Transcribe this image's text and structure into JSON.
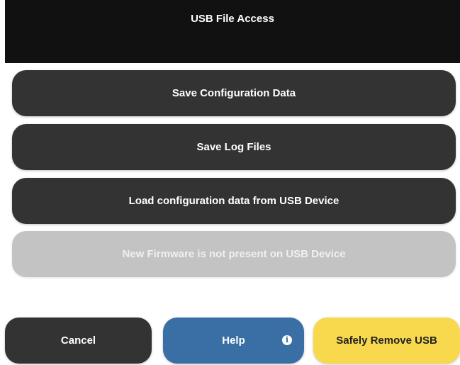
{
  "header": {
    "title": "USB File Access"
  },
  "actions": [
    {
      "label": "Save Configuration Data",
      "enabled": true
    },
    {
      "label": "Save Log Files",
      "enabled": true
    },
    {
      "label": "Load configuration data from USB Device",
      "enabled": true
    },
    {
      "label": "New Firmware is not present on USB Device",
      "enabled": false
    }
  ],
  "footer": {
    "cancel_label": "Cancel",
    "help_label": "Help",
    "help_icon": "info-icon",
    "safe_remove_label": "Safely Remove USB"
  },
  "colors": {
    "header_bg": "#111111",
    "button_dark": "#333333",
    "button_disabled": "#c3c3c3",
    "help_blue": "#3a6fa5",
    "safe_yellow": "#f8d94e"
  }
}
